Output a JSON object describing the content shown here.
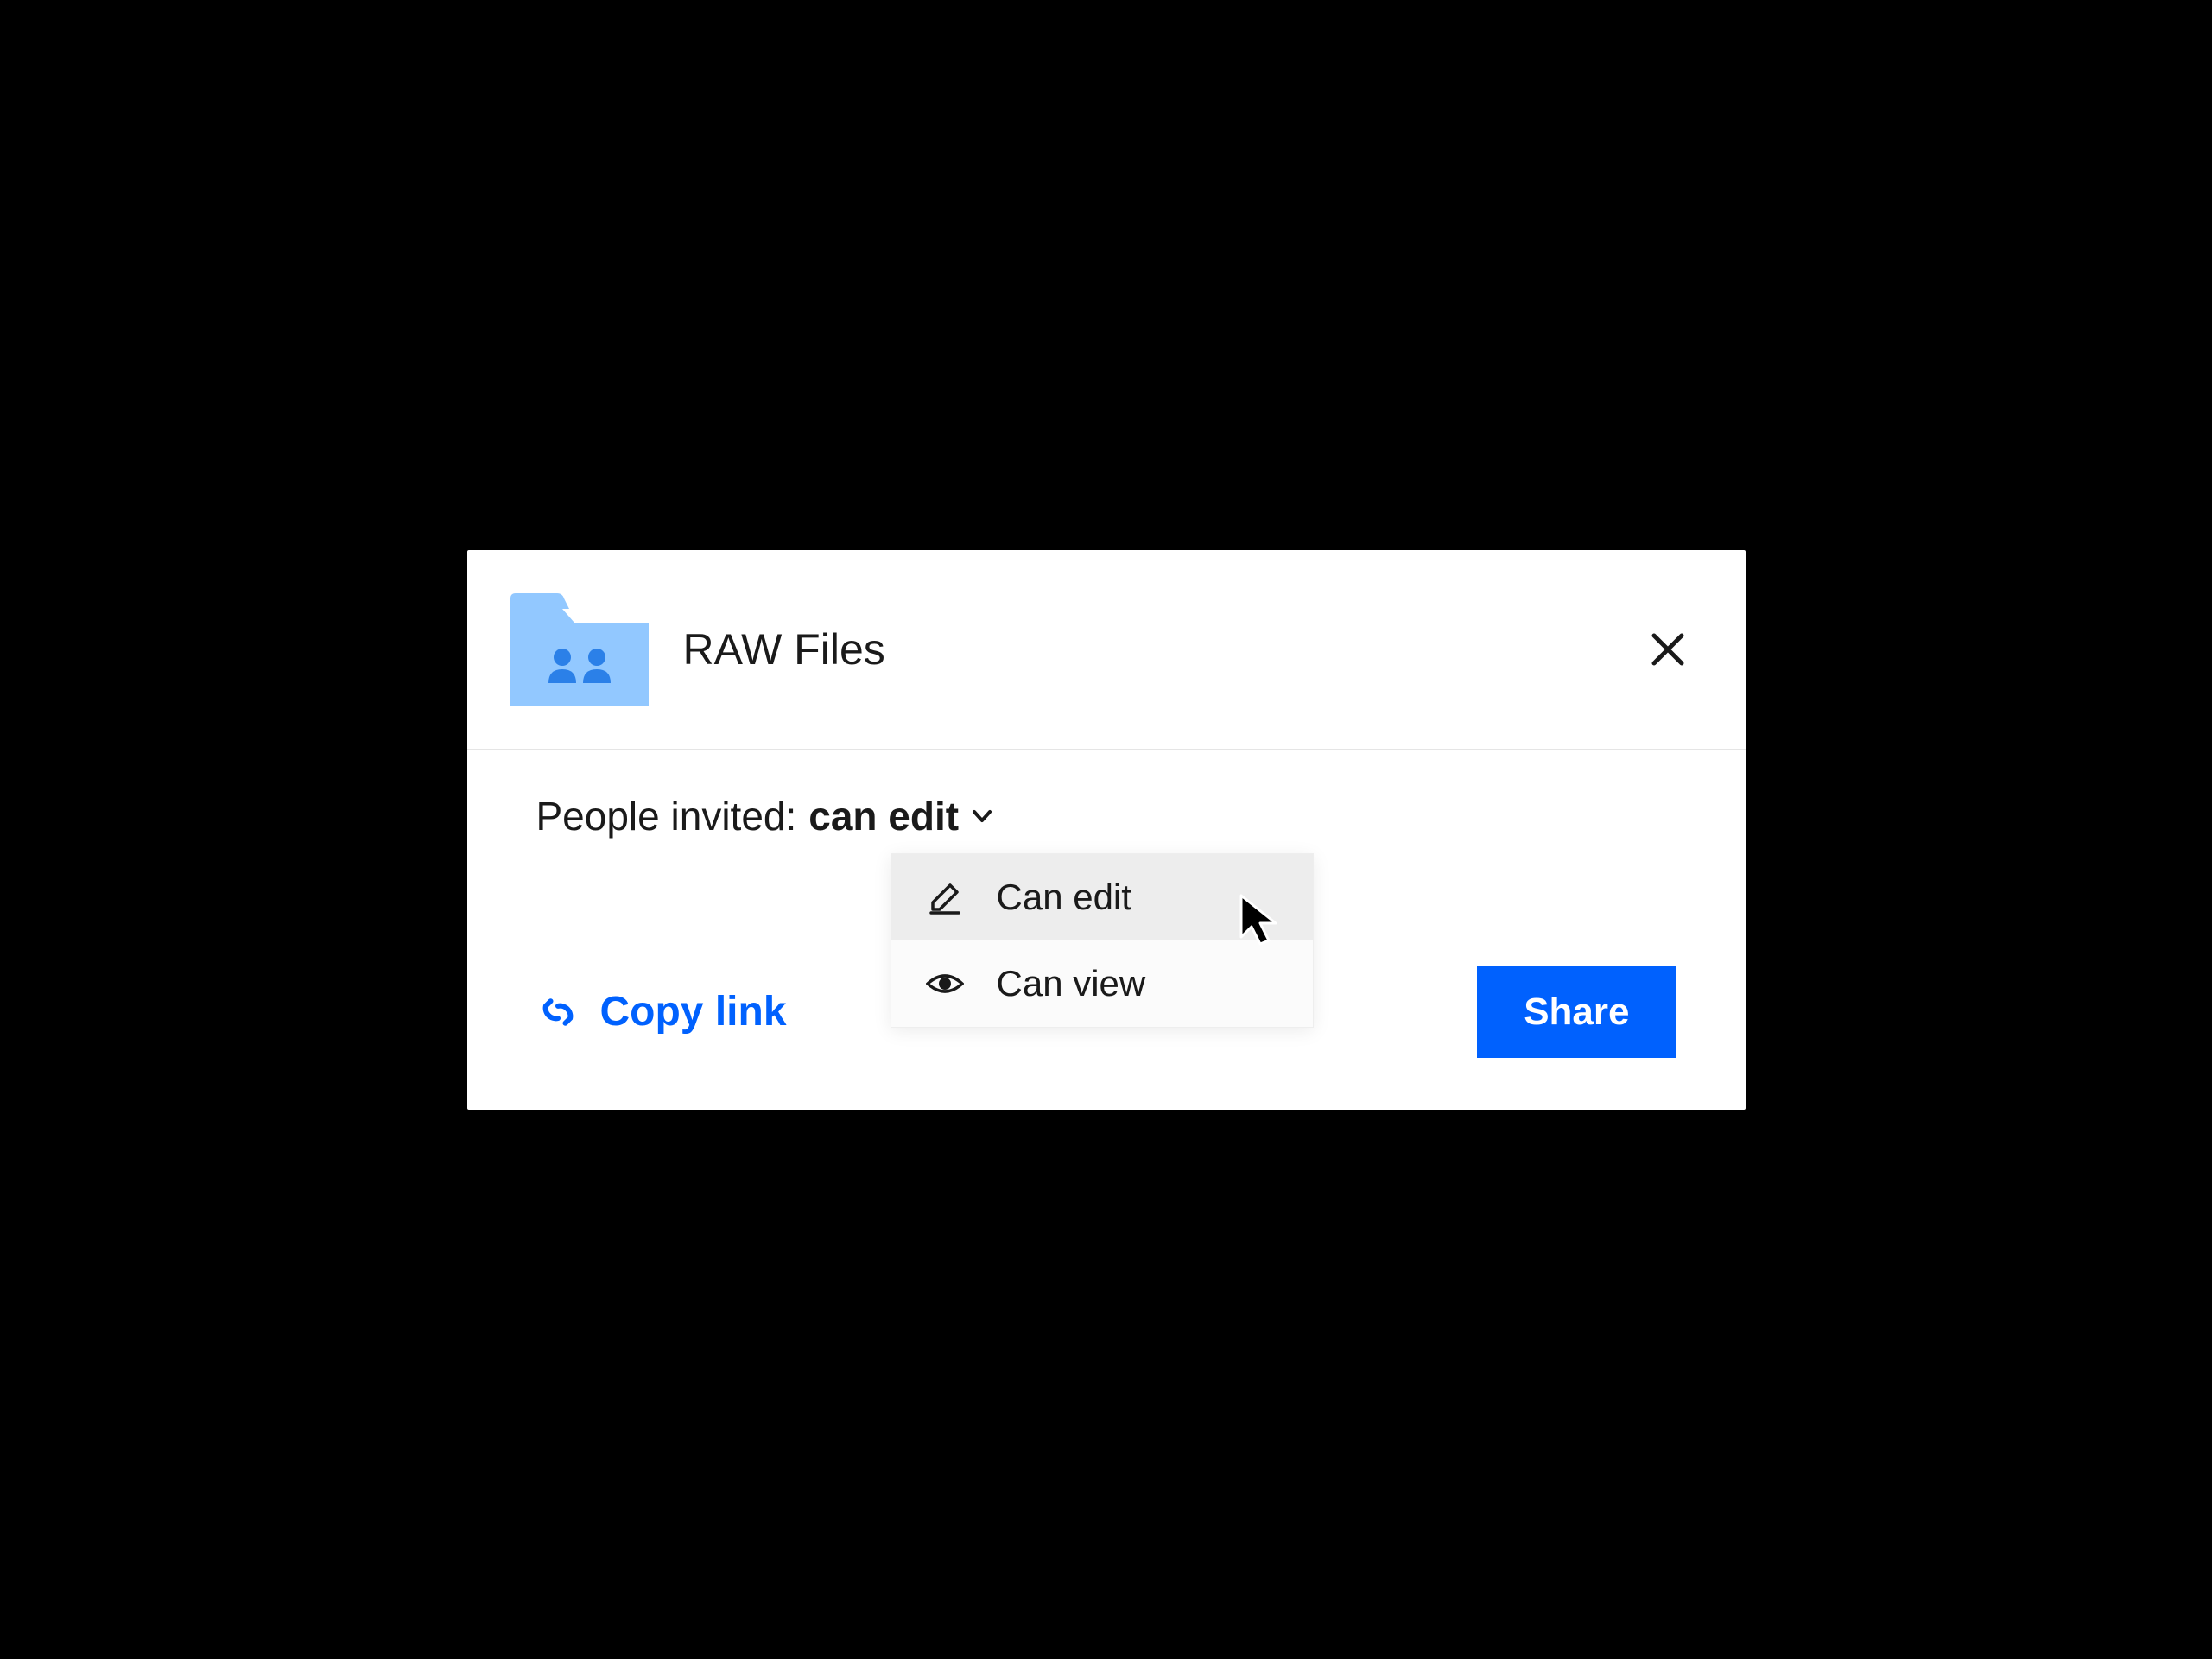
{
  "header": {
    "folder_name": "RAW Files"
  },
  "body": {
    "invite_label": "People invited:",
    "selected_permission": "can edit",
    "dropdown": {
      "options": [
        {
          "label": "Can edit",
          "icon": "pencil-icon"
        },
        {
          "label": "Can view",
          "icon": "eye-icon"
        }
      ]
    }
  },
  "footer": {
    "copy_link_label": "Copy link",
    "share_label": "Share"
  },
  "colors": {
    "accent": "#0061fe",
    "folder_fill": "#92c8ff"
  }
}
